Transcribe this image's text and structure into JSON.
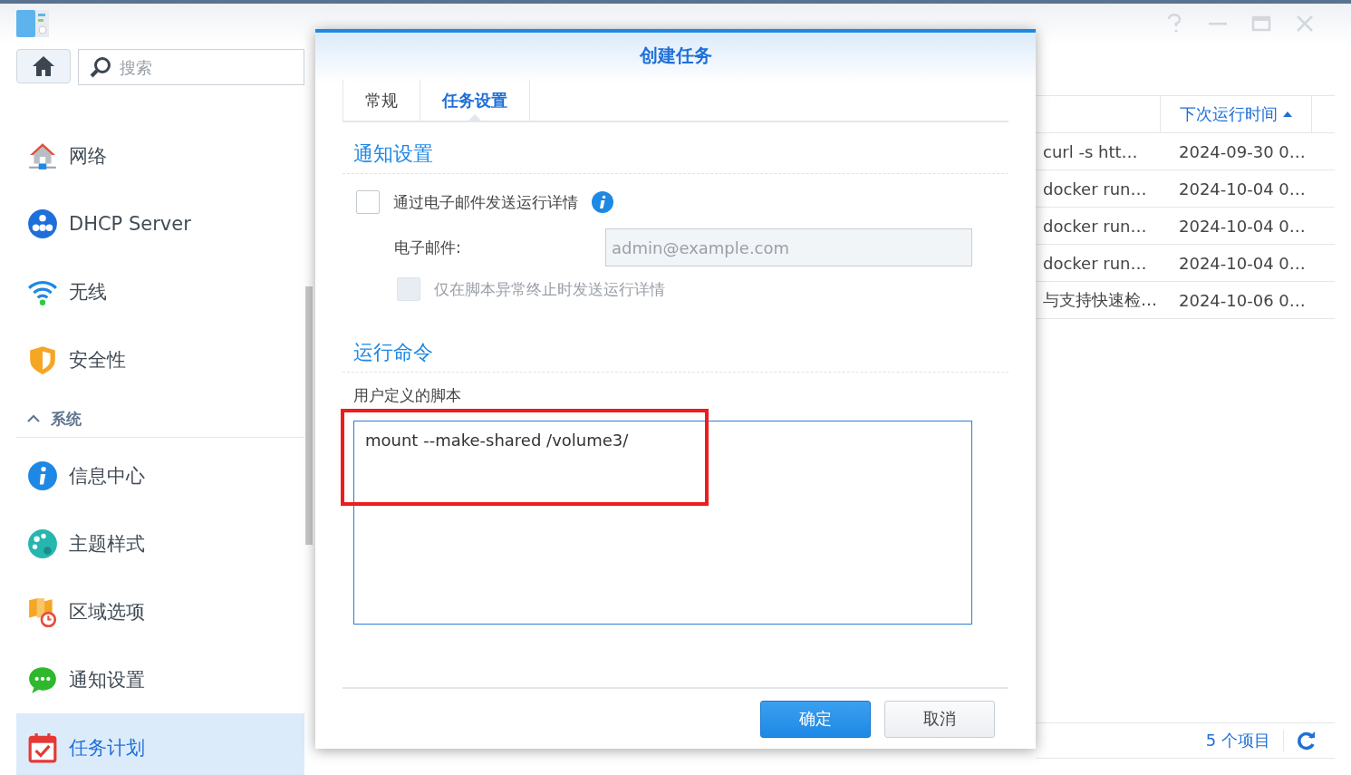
{
  "sidebar": {
    "search": {
      "placeholder": "搜索"
    },
    "items": [
      {
        "kind": "item",
        "label": "网络",
        "selected": false
      },
      {
        "kind": "item",
        "label": "DHCP Server",
        "selected": false
      },
      {
        "kind": "item",
        "label": "无线",
        "selected": false
      },
      {
        "kind": "item",
        "label": "安全性",
        "selected": false
      },
      {
        "kind": "group",
        "label": "系统",
        "expanded": true
      },
      {
        "kind": "item",
        "label": "信息中心",
        "selected": false
      },
      {
        "kind": "item",
        "label": "主题样式",
        "selected": false
      },
      {
        "kind": "item",
        "label": "区域选项",
        "selected": false
      },
      {
        "kind": "item",
        "label": "通知设置",
        "selected": false
      },
      {
        "kind": "item",
        "label": "任务计划",
        "selected": true
      }
    ]
  },
  "table": {
    "columns": [
      {
        "label": "下次运行时间",
        "sorted": true
      }
    ],
    "rows": [
      {
        "column_1": "curl -s htt…",
        "next_run": "2024-09-30 0…"
      },
      {
        "column_1": "docker run…",
        "next_run": "2024-10-04 0…"
      },
      {
        "column_1": "docker run…",
        "next_run": "2024-10-04 0…"
      },
      {
        "column_1": "docker run…",
        "next_run": "2024-10-04 0…"
      },
      {
        "column_1": "与支持快速检…",
        "next_run": "2024-10-06 0…"
      }
    ],
    "item_count": "5 个项目"
  },
  "dialog": {
    "title": "创建任务",
    "tabs": [
      {
        "label": "常规",
        "selected": false
      },
      {
        "label": "任务设置",
        "selected": true
      }
    ],
    "notify_heading": "通知设置",
    "send_email": {
      "label": "通过电子邮件发送运行详情",
      "checked": false
    },
    "email": {
      "label": "电子邮件:",
      "value": "admin@example.com",
      "disabled": true
    },
    "only_on_error": {
      "label": "仅在脚本异常终止时发送运行详情",
      "checked": false,
      "disabled": true
    },
    "command_heading": "运行命令",
    "script_label": "用户定义的脚本",
    "script": "mount --make-shared /volume3/",
    "buttons": [
      {
        "kind": "primary",
        "label": "确定"
      },
      {
        "kind": "secondary",
        "label": "取消"
      }
    ]
  }
}
